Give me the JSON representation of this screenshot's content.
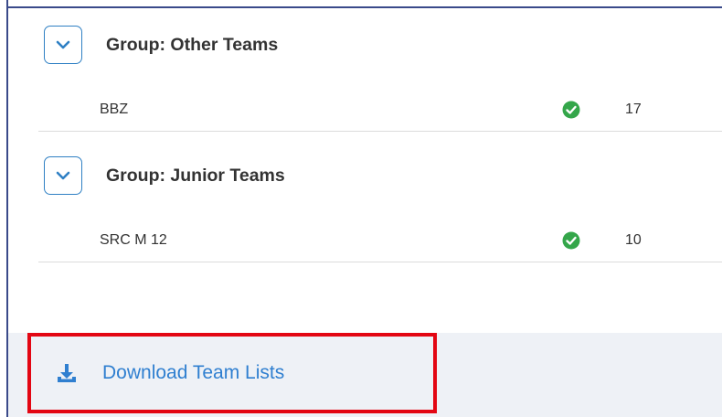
{
  "groups": [
    {
      "title": "Group: Other Teams",
      "toggle_icon": "chevron-down-icon",
      "teams": [
        {
          "name": "BBZ",
          "status_icon": "check-circle-icon",
          "count": "17"
        }
      ]
    },
    {
      "title": "Group: Junior Teams",
      "toggle_icon": "chevron-down-icon",
      "teams": [
        {
          "name": "SRC M 12",
          "status_icon": "check-circle-icon",
          "count": "10"
        }
      ]
    }
  ],
  "footer": {
    "download_label": "Download Team Lists",
    "download_icon": "download-icon"
  },
  "colors": {
    "accent": "#2f80c4",
    "status_ok": "#34a64a",
    "highlight": "#e30613",
    "footer_bg": "#eef1f6",
    "text": "#333333"
  }
}
